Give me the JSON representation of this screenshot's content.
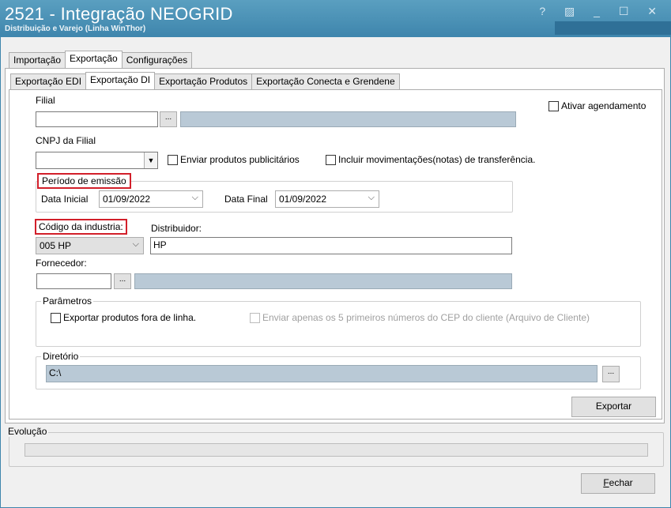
{
  "window": {
    "title": "2521 - Integração NEOGRID",
    "subtitle": "Distribuição e Varejo (Linha WinThor)",
    "controls": "? ▨ _ ☐ ✕"
  },
  "main_tabs": [
    "Importação",
    "Exportação",
    "Configurações"
  ],
  "sub_tabs": [
    "Exportação EDI",
    "Exportação DI",
    "Exportação Produtos",
    "Exportação Conecta e Grendene"
  ],
  "filial": {
    "label": "Filial",
    "value": "",
    "dots": "...",
    "description": ""
  },
  "agendamento": {
    "label": "Ativar agendamento"
  },
  "cnpj": {
    "label": "CNPJ da Filial",
    "value": ""
  },
  "enviar_publicitarios": {
    "label": "Enviar produtos publicitários"
  },
  "incluir_transferencia": {
    "label": "Incluir movimentações(notas) de transferência."
  },
  "periodo": {
    "title": "Período de emissão",
    "data_inicial_label": "Data Inicial",
    "data_inicial": "01/09/2022",
    "data_final_label": "Data Final",
    "data_final": "01/09/2022"
  },
  "codigo_industria": {
    "label": "Código da industria:",
    "value": "005 HP"
  },
  "distribuidor": {
    "label": "Distribuidor:",
    "value": "HP"
  },
  "fornecedor": {
    "label": "Fornecedor:",
    "value": "",
    "dots": "...",
    "description": ""
  },
  "parametros": {
    "title": "Parâmetros",
    "fora_linha": "Exportar produtos fora de linha.",
    "cep": "Enviar apenas os 5 primeiros números do CEP do cliente (Arquivo de Cliente)"
  },
  "diretorio": {
    "title": "Diretório",
    "value": "C:\\",
    "dots": "..."
  },
  "exportar_button": "Exportar",
  "evolucao": {
    "title": "Evolução",
    "progress": 0
  },
  "fechar_button": "Fechar",
  "colors": {
    "titlebar": "#3f86ad",
    "highlight": "#d21f2a",
    "readonly": "#b9c9d6"
  }
}
